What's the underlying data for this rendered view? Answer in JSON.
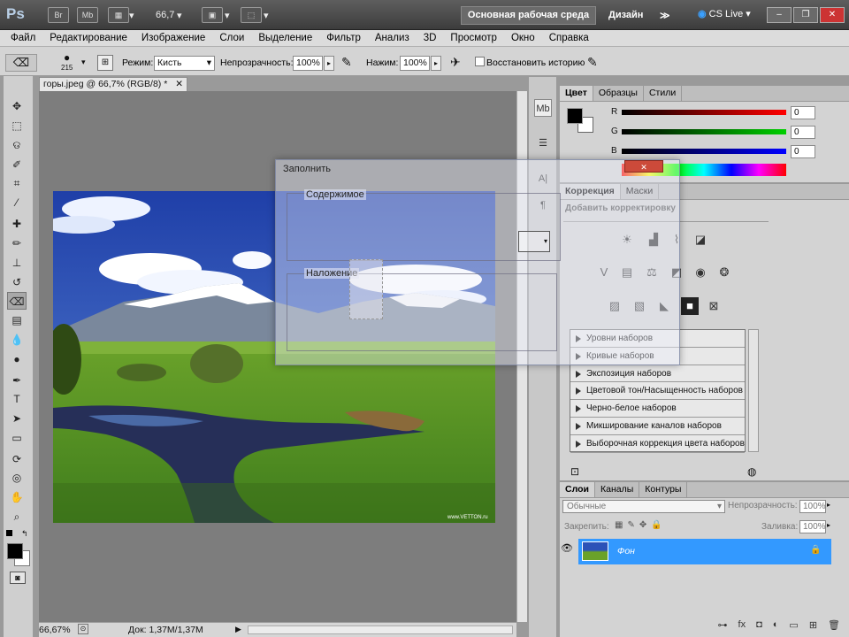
{
  "app": {
    "logo": "Ps",
    "bridge_icon": "Br",
    "minibridge_icon": "Mb",
    "zoom": "66,7",
    "workspace_main": "Основная рабочая среда",
    "workspace_design": "Дизайн",
    "more": "≫",
    "cs_live": "CS Live"
  },
  "menu": [
    "Файл",
    "Редактирование",
    "Изображение",
    "Слои",
    "Выделение",
    "Фильтр",
    "Анализ",
    "3D",
    "Просмотр",
    "Окно",
    "Справка"
  ],
  "options": {
    "brush_size": "215",
    "mode_label": "Режим:",
    "mode_value": "Кисть",
    "opacity_label": "Непрозрачность:",
    "opacity_value": "100%",
    "flow_label": "Нажим:",
    "flow_value": "100%",
    "history_label": "Восстановить историю"
  },
  "document": {
    "tab_title": "горы.jpeg @ 66,7% (RGB/8) *",
    "zoom": "66,67%",
    "doc_size": "Док: 1,37M/1,37M",
    "watermark": "www.VETTON.ru"
  },
  "color_panel": {
    "tabs": [
      "Цвет",
      "Образцы",
      "Стили"
    ],
    "channels": [
      {
        "label": "R",
        "value": "0",
        "color": "#ff0000"
      },
      {
        "label": "G",
        "value": "0",
        "color": "#00c000"
      },
      {
        "label": "B",
        "value": "0",
        "color": "#0000ff"
      }
    ]
  },
  "adjust_panel": {
    "tabs": [
      "Коррекция",
      "Маски"
    ],
    "heading": "Добавить корректировку",
    "presets": [
      "Уровни наборов",
      "Кривые наборов",
      "Экспозиция наборов",
      "Цветовой тон/Насыщенность наборов",
      "Черно-белое наборов",
      "Микширование каналов наборов",
      "Выборочная коррекция цвета наборов"
    ]
  },
  "layers_panel": {
    "tabs": [
      "Слои",
      "Каналы",
      "Контуры"
    ],
    "blend_mode": "Обычные",
    "opacity_label": "Непрозрачность:",
    "opacity_value": "100%",
    "lock_label": "Закрепить:",
    "fill_label": "Заливка:",
    "fill_value": "100%",
    "layer_name": "Фон"
  },
  "dialog": {
    "title": "Заполнить",
    "group_content": "Содержимое",
    "group_blend": "Наложение"
  },
  "colors": {
    "accent": "#3399ff",
    "chrome": "#4a4a4a",
    "panel": "#d3d3d3"
  }
}
